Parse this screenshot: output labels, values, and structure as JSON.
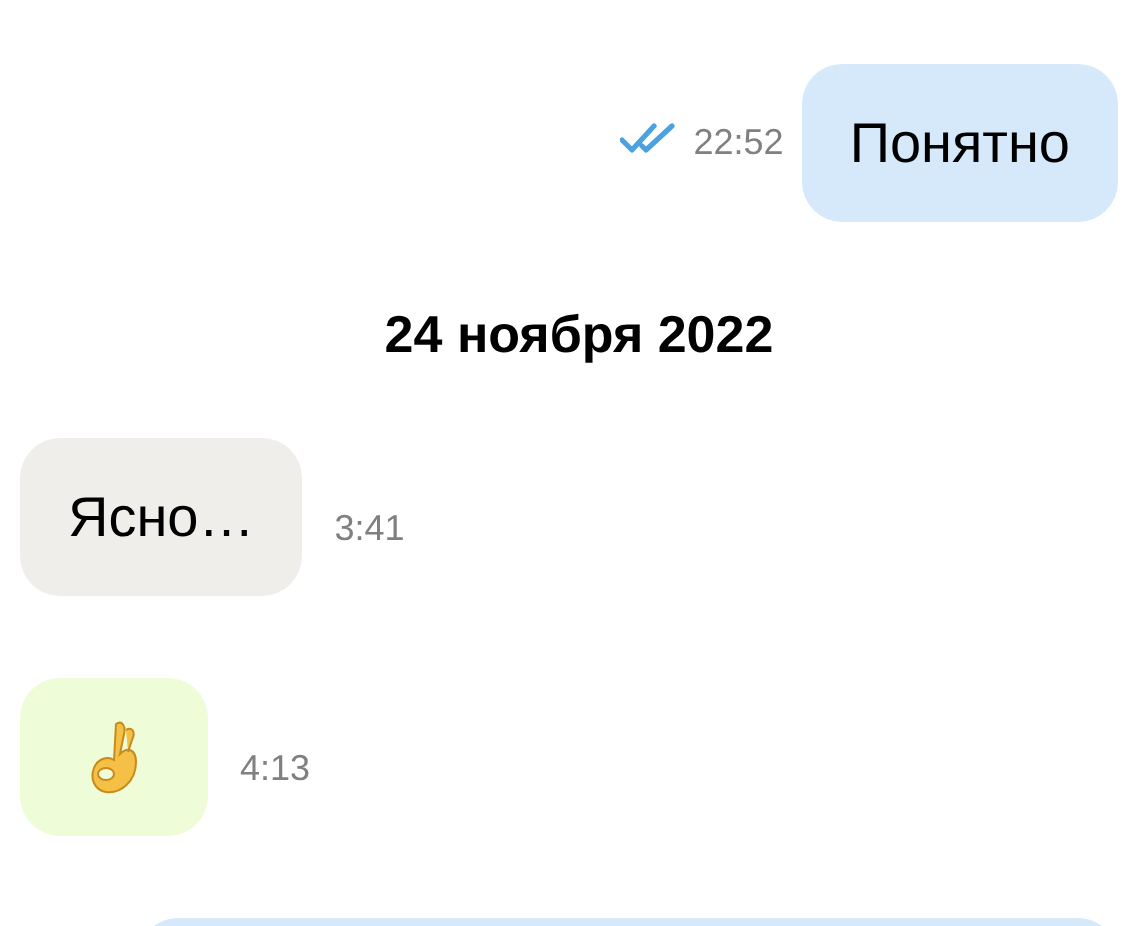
{
  "messages": [
    {
      "kind": "text",
      "outgoing": true,
      "text": "Понятно",
      "time": "22:52",
      "read": true
    },
    {
      "kind": "date",
      "text": "24 ноября 2022"
    },
    {
      "kind": "text",
      "outgoing": false,
      "text": "Ясно…",
      "time": "3:41"
    },
    {
      "kind": "sticker",
      "outgoing": false,
      "time": "4:13"
    },
    {
      "kind": "cut",
      "outgoing": true
    }
  ]
}
